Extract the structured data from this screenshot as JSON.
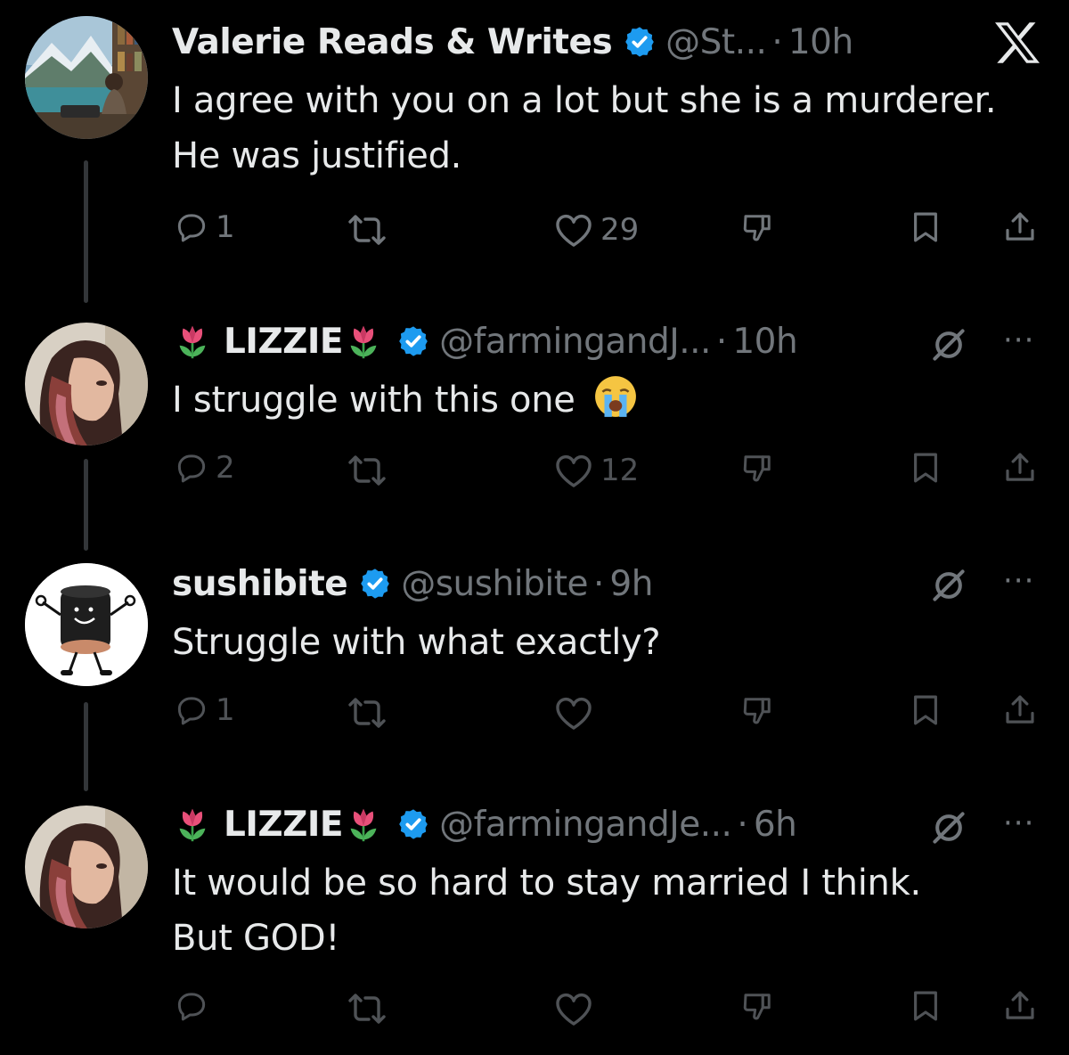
{
  "posts": [
    {
      "name": "Valerie Reads & Writes",
      "handle": "@St...",
      "time": "10h",
      "text": "I agree with you on a lot but she is a murderer.\nHe was justified.",
      "replies": "1",
      "likes": "29",
      "avatar": "landscape-writer-avatar"
    },
    {
      "name": "LIZZIE",
      "handle": "@farmingandJ...",
      "time": "10h",
      "text": "I struggle with this one",
      "emoji": "crying-face",
      "replies": "2",
      "likes": "12",
      "avatar": "woman-portrait-avatar"
    },
    {
      "name": "sushibite",
      "handle": "@sushibite",
      "time": "9h",
      "text": "Struggle with what exactly?",
      "replies": "1",
      "likes": "",
      "avatar": "cartoon-mascot-avatar"
    },
    {
      "name": "LIZZIE",
      "handle": "@farmingandJe...",
      "time": "6h",
      "text": "It would be so hard to stay married I think.\nBut GOD!",
      "replies": "",
      "likes": "",
      "avatar": "woman-portrait-avatar"
    }
  ],
  "separator": "·",
  "more": "···",
  "colors": {
    "background": "#000000",
    "text": "#e7e9ea",
    "muted": "#71767b",
    "verified": "#1d9bf0"
  }
}
